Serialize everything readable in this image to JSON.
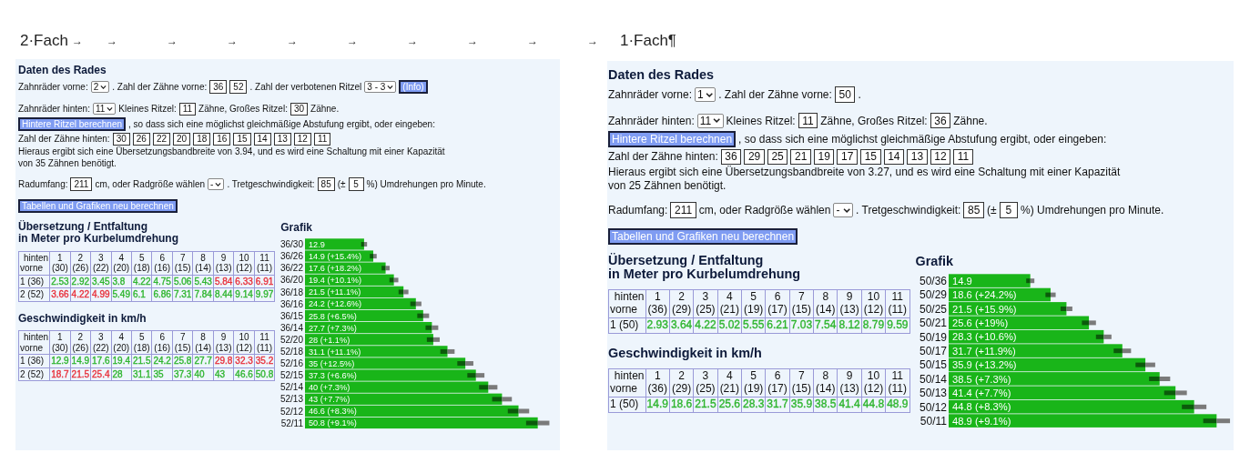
{
  "document": {
    "left_heading": "2·Fach",
    "tab_marks": [
      "→",
      "→",
      "→",
      "→",
      "→",
      "→",
      "→",
      "→",
      "→",
      "→"
    ],
    "right_heading": "1·Fach¶"
  },
  "panels": [
    {
      "title": "Daten des Rades",
      "paragraphs": [
        [
          [
            {
              "kind": "text",
              "text": "Zahnräder vorne:"
            },
            {
              "kind": "select",
              "value": "2"
            },
            {
              "kind": "text",
              "text": ". Zahl der Zähne vorne:"
            },
            {
              "kind": "input",
              "value": "36"
            },
            {
              "kind": "input",
              "value": "52"
            },
            {
              "kind": "text",
              "text": ". Zahl der verbotenen Ritzel"
            },
            {
              "kind": "select",
              "value": "3 - 3"
            },
            {
              "kind": "button",
              "text": "(Info)"
            }
          ]
        ],
        [
          [
            {
              "kind": "text",
              "text": "Zahnräder hinten:"
            },
            {
              "kind": "select",
              "value": "11"
            },
            {
              "kind": "text",
              "text": "Kleines Ritzel:"
            },
            {
              "kind": "input",
              "value": "11"
            },
            {
              "kind": "text",
              "text": "Zähne, Großes Ritzel:"
            },
            {
              "kind": "input",
              "value": "30"
            },
            {
              "kind": "text",
              "text": "Zähne."
            }
          ],
          [
            {
              "kind": "button",
              "text": "Hintere Ritzel berechnen"
            },
            {
              "kind": "text",
              "text": ", so dass sich eine möglichst gleichmäßige Abstufung ergibt, oder eingeben:"
            }
          ],
          [
            {
              "kind": "text",
              "text": "Zahl der Zähne hinten:"
            },
            {
              "kind": "input",
              "value": "30"
            },
            {
              "kind": "input",
              "value": "26"
            },
            {
              "kind": "input",
              "value": "22"
            },
            {
              "kind": "input",
              "value": "20"
            },
            {
              "kind": "input",
              "value": "18"
            },
            {
              "kind": "input",
              "value": "16"
            },
            {
              "kind": "input",
              "value": "15"
            },
            {
              "kind": "input",
              "value": "14"
            },
            {
              "kind": "input",
              "value": "13"
            },
            {
              "kind": "input",
              "value": "12"
            },
            {
              "kind": "input",
              "value": "11"
            }
          ],
          [
            {
              "kind": "paragraph",
              "text": "Hieraus ergibt sich eine Übersetzungsbandbreite von 3.94, und es wird eine Schaltung mit einer Kapazität von 35 Zähnen benötigt."
            }
          ]
        ],
        [
          [
            {
              "kind": "text",
              "text": "Radumfang:"
            },
            {
              "kind": "input",
              "value": "211"
            },
            {
              "kind": "text",
              "text": "cm, oder Radgröße wählen"
            },
            {
              "kind": "select",
              "value": "-"
            },
            {
              "kind": "text",
              "text": ". Tretgeschwindigkeit:"
            },
            {
              "kind": "input",
              "value": "85"
            },
            {
              "kind": "text",
              "text": "(±"
            },
            {
              "kind": "input",
              "value": "5"
            },
            {
              "kind": "text",
              "text": "%) Umdrehungen pro Minute."
            }
          ]
        ],
        [
          [
            {
              "kind": "button",
              "text": "Tabellen und Grafiken neu berechnen"
            }
          ]
        ]
      ],
      "tables": [
        {
          "title_lines": [
            "Übersetzung / Entfaltung",
            "in Meter pro Kurbelumdrehung"
          ],
          "corner": [
            "hinten",
            "vorne"
          ],
          "columns": [
            {
              "index": "1",
              "teeth": "(30)"
            },
            {
              "index": "2",
              "teeth": "(26)"
            },
            {
              "index": "3",
              "teeth": "(22)"
            },
            {
              "index": "4",
              "teeth": "(20)"
            },
            {
              "index": "5",
              "teeth": "(18)"
            },
            {
              "index": "6",
              "teeth": "(16)"
            },
            {
              "index": "7",
              "teeth": "(15)"
            },
            {
              "index": "8",
              "teeth": "(14)"
            },
            {
              "index": "9",
              "teeth": "(13)"
            },
            {
              "index": "10",
              "teeth": "(12)"
            },
            {
              "index": "11",
              "teeth": "(11)"
            }
          ],
          "rows": [
            {
              "label": "1 (36)",
              "cells": [
                {
                  "text": "2.53",
                  "color": "#2fb52f"
                },
                {
                  "text": "2.92",
                  "color": "#2fb52f"
                },
                {
                  "text": "3.45",
                  "color": "#2fb52f"
                },
                {
                  "text": "3.8",
                  "color": "#2fb52f"
                },
                {
                  "text": "4.22",
                  "color": "#2fb52f"
                },
                {
                  "text": "4.75",
                  "color": "#2fb52f"
                },
                {
                  "text": "5.06",
                  "color": "#2fb52f"
                },
                {
                  "text": "5.43",
                  "color": "#2fb52f"
                },
                {
                  "text": "5.84",
                  "color": "#e8303a"
                },
                {
                  "text": "6.33",
                  "color": "#e8303a"
                },
                {
                  "text": "6.91",
                  "color": "#e8303a"
                }
              ]
            },
            {
              "label": "2 (52)",
              "cells": [
                {
                  "text": "3.66",
                  "color": "#e8303a"
                },
                {
                  "text": "4.22",
                  "color": "#e8303a"
                },
                {
                  "text": "4.99",
                  "color": "#e8303a"
                },
                {
                  "text": "5.49",
                  "color": "#2fb52f"
                },
                {
                  "text": "6.1",
                  "color": "#2fb52f"
                },
                {
                  "text": "6.86",
                  "color": "#2fb52f"
                },
                {
                  "text": "7.31",
                  "color": "#2fb52f"
                },
                {
                  "text": "7.84",
                  "color": "#2fb52f"
                },
                {
                  "text": "8.44",
                  "color": "#2fb52f"
                },
                {
                  "text": "9.14",
                  "color": "#2fb52f"
                },
                {
                  "text": "9.97",
                  "color": "#2fb52f"
                }
              ]
            }
          ]
        },
        {
          "title_lines": [
            "Geschwindigkeit in km/h"
          ],
          "corner": [
            "hinten",
            "vorne"
          ],
          "columns": [
            {
              "index": "1",
              "teeth": "(30)"
            },
            {
              "index": "2",
              "teeth": "(26)"
            },
            {
              "index": "3",
              "teeth": "(22)"
            },
            {
              "index": "4",
              "teeth": "(20)"
            },
            {
              "index": "5",
              "teeth": "(18)"
            },
            {
              "index": "6",
              "teeth": "(16)"
            },
            {
              "index": "7",
              "teeth": "(15)"
            },
            {
              "index": "8",
              "teeth": "(14)"
            },
            {
              "index": "9",
              "teeth": "(13)"
            },
            {
              "index": "10",
              "teeth": "(12)"
            },
            {
              "index": "11",
              "teeth": "(11)"
            }
          ],
          "rows": [
            {
              "label": "1 (36)",
              "cells": [
                {
                  "text": "12.9",
                  "color": "#2fb52f"
                },
                {
                  "text": "14.9",
                  "color": "#2fb52f"
                },
                {
                  "text": "17.6",
                  "color": "#2fb52f"
                },
                {
                  "text": "19.4",
                  "color": "#2fb52f"
                },
                {
                  "text": "21.5",
                  "color": "#2fb52f"
                },
                {
                  "text": "24.2",
                  "color": "#2fb52f"
                },
                {
                  "text": "25.8",
                  "color": "#2fb52f"
                },
                {
                  "text": "27.7",
                  "color": "#2fb52f"
                },
                {
                  "text": "29.8",
                  "color": "#e8303a"
                },
                {
                  "text": "32.3",
                  "color": "#e8303a"
                },
                {
                  "text": "35.2",
                  "color": "#e8303a"
                }
              ]
            },
            {
              "label": "2 (52)",
              "cells": [
                {
                  "text": "18.7",
                  "color": "#e8303a"
                },
                {
                  "text": "21.5",
                  "color": "#e8303a"
                },
                {
                  "text": "25.4",
                  "color": "#e8303a"
                },
                {
                  "text": "28",
                  "color": "#2fb52f"
                },
                {
                  "text": "31.1",
                  "color": "#2fb52f"
                },
                {
                  "text": "35",
                  "color": "#2fb52f"
                },
                {
                  "text": "37.3",
                  "color": "#2fb52f"
                },
                {
                  "text": "40",
                  "color": "#2fb52f"
                },
                {
                  "text": "43",
                  "color": "#2fb52f"
                },
                {
                  "text": "46.6",
                  "color": "#2fb52f"
                },
                {
                  "text": "50.8",
                  "color": "#2fb52f"
                }
              ]
            }
          ]
        }
      ],
      "chart_title": "Grafik",
      "chart_data": {
        "type": "bar",
        "orientation": "horizontal",
        "categories": [
          "36/30",
          "36/26",
          "36/22",
          "36/20",
          "36/18",
          "36/16",
          "36/15",
          "36/14",
          "52/20",
          "52/18",
          "52/16",
          "52/15",
          "52/14",
          "52/13",
          "52/12",
          "52/11"
        ],
        "values": [
          12.9,
          14.9,
          17.6,
          19.4,
          21.5,
          24.2,
          25.8,
          27.7,
          28,
          31.1,
          35,
          37.3,
          40,
          43,
          46.6,
          50.8
        ],
        "value_labels": [
          "12.9",
          "14.9 (+15.4%)",
          "17.6 (+18.2%)",
          "19.4 (+10.1%)",
          "21.5 (+11.1%)",
          "24.2 (+12.6%)",
          "25.8 (+6.5%)",
          "27.7 (+7.3%)",
          "28 (+1.1%)",
          "31.1 (+11.1%)",
          "35 (+12.5%)",
          "37.3 (+6.6%)",
          "40 (+7.3%)",
          "43 (+7.7%)",
          "46.6 (+8.3%)",
          "50.8 (+9.1%)"
        ]
      }
    },
    {
      "title": "Daten des Rades",
      "paragraphs": [
        [
          [
            {
              "kind": "text",
              "text": "Zahnräder vorne:"
            },
            {
              "kind": "select",
              "value": "1"
            },
            {
              "kind": "text",
              "text": ". Zahl der Zähne vorne:"
            },
            {
              "kind": "input",
              "value": "50"
            },
            {
              "kind": "text",
              "text": "."
            }
          ]
        ],
        [
          [
            {
              "kind": "text",
              "text": "Zahnräder hinten:"
            },
            {
              "kind": "select",
              "value": "11"
            },
            {
              "kind": "text",
              "text": "Kleines Ritzel:"
            },
            {
              "kind": "input",
              "value": "11"
            },
            {
              "kind": "text",
              "text": "Zähne, Großes Ritzel:"
            },
            {
              "kind": "input",
              "value": "36"
            },
            {
              "kind": "text",
              "text": "Zähne."
            }
          ],
          [
            {
              "kind": "button",
              "text": "Hintere Ritzel berechnen"
            },
            {
              "kind": "text",
              "text": ", so dass sich eine möglichst gleichmäßige Abstufung ergibt, oder eingeben:"
            }
          ],
          [
            {
              "kind": "text",
              "text": "Zahl der Zähne hinten:"
            },
            {
              "kind": "input",
              "value": "36"
            },
            {
              "kind": "input",
              "value": "29"
            },
            {
              "kind": "input",
              "value": "25"
            },
            {
              "kind": "input",
              "value": "21"
            },
            {
              "kind": "input",
              "value": "19"
            },
            {
              "kind": "input",
              "value": "17"
            },
            {
              "kind": "input",
              "value": "15"
            },
            {
              "kind": "input",
              "value": "14"
            },
            {
              "kind": "input",
              "value": "13"
            },
            {
              "kind": "input",
              "value": "12"
            },
            {
              "kind": "input",
              "value": "11"
            }
          ],
          [
            {
              "kind": "paragraph",
              "text": "Hieraus ergibt sich eine Übersetzungsbandbreite von 3.27, und es wird eine Schaltung mit einer Kapazität von 25 Zähnen benötigt."
            }
          ]
        ],
        [
          [
            {
              "kind": "text",
              "text": "Radumfang:"
            },
            {
              "kind": "input",
              "value": "211"
            },
            {
              "kind": "text",
              "text": "cm, oder Radgröße wählen"
            },
            {
              "kind": "select",
              "value": "-"
            },
            {
              "kind": "text",
              "text": ". Tretgeschwindigkeit:"
            },
            {
              "kind": "input",
              "value": "85"
            },
            {
              "kind": "text",
              "text": "(±"
            },
            {
              "kind": "input",
              "value": "5"
            },
            {
              "kind": "text",
              "text": "%) Umdrehungen pro Minute."
            }
          ]
        ],
        [
          [
            {
              "kind": "button",
              "text": "Tabellen und Grafiken neu berechnen"
            }
          ]
        ]
      ],
      "tables": [
        {
          "title_lines": [
            "Übersetzung / Entfaltung",
            "in Meter pro Kurbelumdrehung"
          ],
          "corner": [
            "hinten",
            "vorne"
          ],
          "columns": [
            {
              "index": "1",
              "teeth": "(36)"
            },
            {
              "index": "2",
              "teeth": "(29)"
            },
            {
              "index": "3",
              "teeth": "(25)"
            },
            {
              "index": "4",
              "teeth": "(21)"
            },
            {
              "index": "5",
              "teeth": "(19)"
            },
            {
              "index": "6",
              "teeth": "(17)"
            },
            {
              "index": "7",
              "teeth": "(15)"
            },
            {
              "index": "8",
              "teeth": "(14)"
            },
            {
              "index": "9",
              "teeth": "(13)"
            },
            {
              "index": "10",
              "teeth": "(12)"
            },
            {
              "index": "11",
              "teeth": "(11)"
            }
          ],
          "rows": [
            {
              "label": "1 (50)",
              "cells": [
                {
                  "text": "2.93",
                  "color": "#2fb52f"
                },
                {
                  "text": "3.64",
                  "color": "#2fb52f"
                },
                {
                  "text": "4.22",
                  "color": "#2fb52f"
                },
                {
                  "text": "5.02",
                  "color": "#2fb52f"
                },
                {
                  "text": "5.55",
                  "color": "#2fb52f"
                },
                {
                  "text": "6.21",
                  "color": "#2fb52f"
                },
                {
                  "text": "7.03",
                  "color": "#2fb52f"
                },
                {
                  "text": "7.54",
                  "color": "#2fb52f"
                },
                {
                  "text": "8.12",
                  "color": "#2fb52f"
                },
                {
                  "text": "8.79",
                  "color": "#2fb52f"
                },
                {
                  "text": "9.59",
                  "color": "#2fb52f"
                }
              ]
            }
          ]
        },
        {
          "title_lines": [
            "Geschwindigkeit in km/h"
          ],
          "corner": [
            "hinten",
            "vorne"
          ],
          "columns": [
            {
              "index": "1",
              "teeth": "(36)"
            },
            {
              "index": "2",
              "teeth": "(29)"
            },
            {
              "index": "3",
              "teeth": "(25)"
            },
            {
              "index": "4",
              "teeth": "(21)"
            },
            {
              "index": "5",
              "teeth": "(19)"
            },
            {
              "index": "6",
              "teeth": "(17)"
            },
            {
              "index": "7",
              "teeth": "(15)"
            },
            {
              "index": "8",
              "teeth": "(14)"
            },
            {
              "index": "9",
              "teeth": "(13)"
            },
            {
              "index": "10",
              "teeth": "(12)"
            },
            {
              "index": "11",
              "teeth": "(11)"
            }
          ],
          "rows": [
            {
              "label": "1 (50)",
              "cells": [
                {
                  "text": "14.9",
                  "color": "#2fb52f"
                },
                {
                  "text": "18.6",
                  "color": "#2fb52f"
                },
                {
                  "text": "21.5",
                  "color": "#2fb52f"
                },
                {
                  "text": "25.6",
                  "color": "#2fb52f"
                },
                {
                  "text": "28.3",
                  "color": "#2fb52f"
                },
                {
                  "text": "31.7",
                  "color": "#2fb52f"
                },
                {
                  "text": "35.9",
                  "color": "#2fb52f"
                },
                {
                  "text": "38.5",
                  "color": "#2fb52f"
                },
                {
                  "text": "41.4",
                  "color": "#2fb52f"
                },
                {
                  "text": "44.8",
                  "color": "#2fb52f"
                },
                {
                  "text": "48.9",
                  "color": "#2fb52f"
                }
              ]
            }
          ]
        }
      ],
      "chart_title": "Grafik",
      "chart_data": {
        "type": "bar",
        "orientation": "horizontal",
        "categories": [
          "50/36",
          "50/29",
          "50/25",
          "50/21",
          "50/19",
          "50/17",
          "50/15",
          "50/14",
          "50/13",
          "50/12",
          "50/11"
        ],
        "values": [
          14.9,
          18.6,
          21.5,
          25.6,
          28.3,
          31.7,
          35.9,
          38.5,
          41.4,
          44.8,
          48.9
        ],
        "value_labels": [
          "14.9",
          "18.6 (+24.2%)",
          "21.5 (+15.9%)",
          "25.6 (+19%)",
          "28.3 (+10.6%)",
          "31.7 (+11.9%)",
          "35.9 (+13.2%)",
          "38.5 (+7.3%)",
          "41.4 (+7.7%)",
          "44.8 (+8.3%)",
          "48.9 (+9.1%)"
        ]
      }
    }
  ]
}
